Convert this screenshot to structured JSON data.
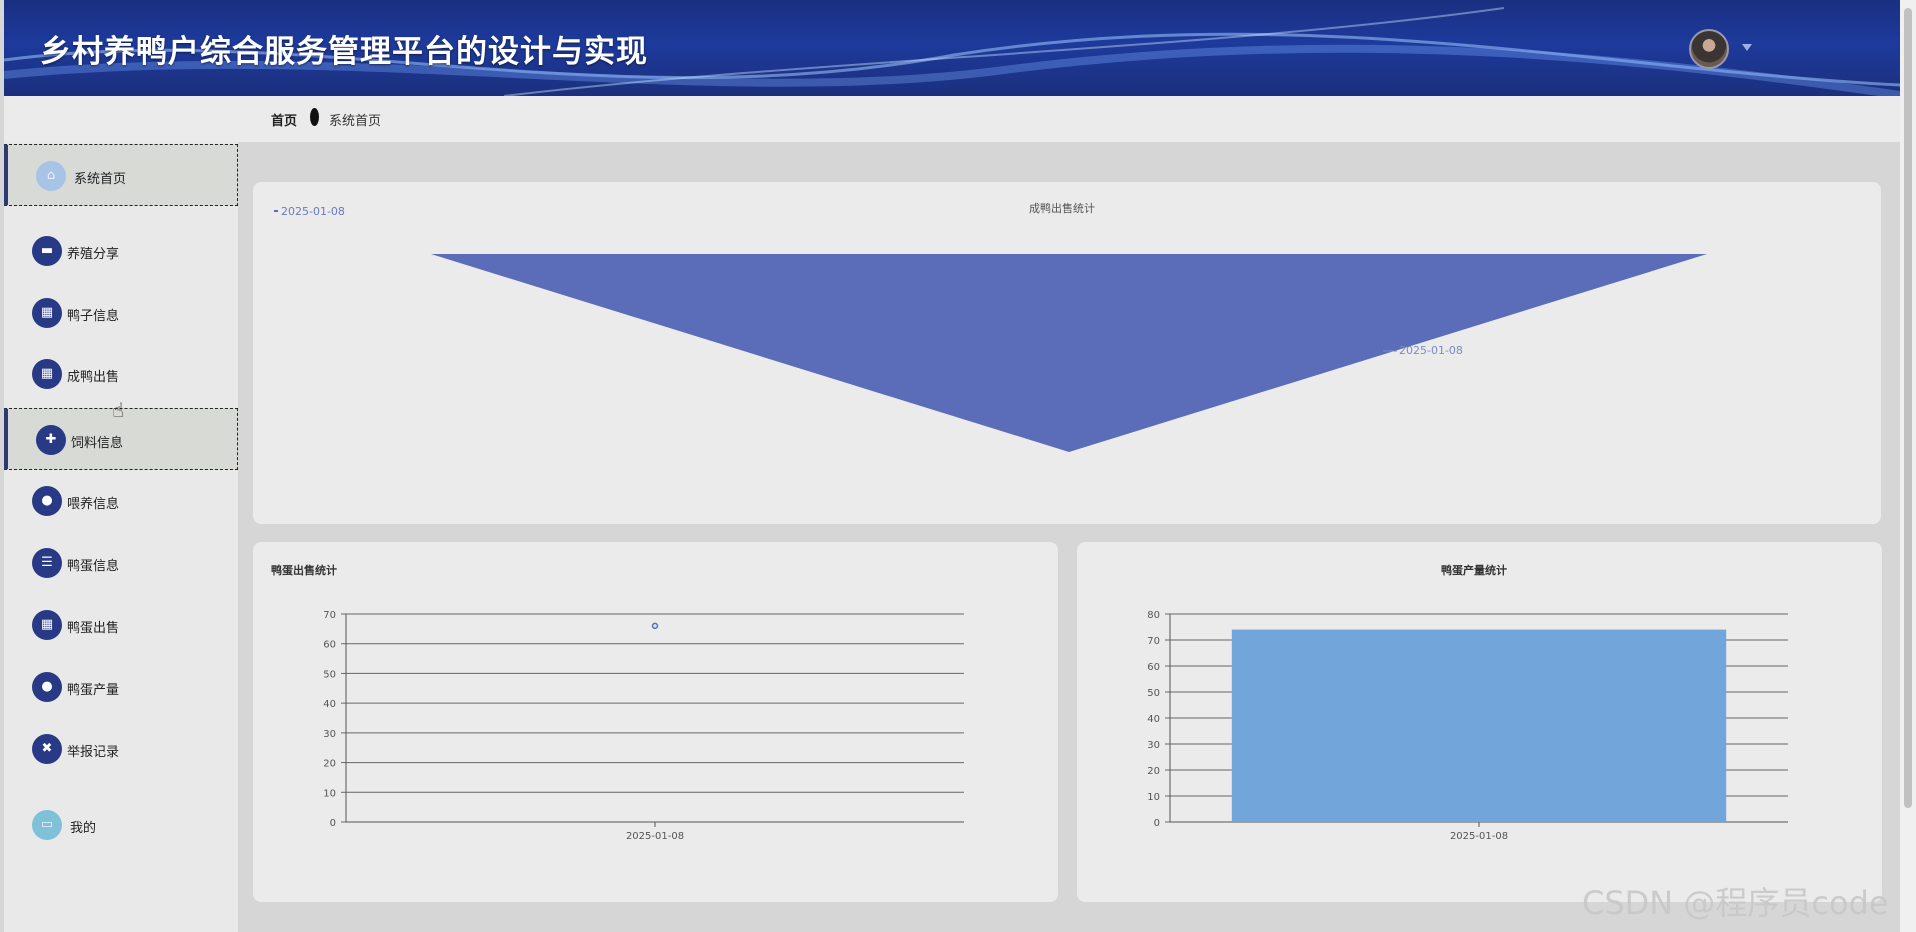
{
  "header": {
    "title": "乡村养鸭户综合服务管理平台的设计与实现"
  },
  "breadcrumb": {
    "home": "首页",
    "current": "系统首页"
  },
  "sidebar": {
    "items": [
      {
        "label": "系统首页",
        "icon": "home-icon",
        "active": true
      },
      {
        "label": "养殖分享",
        "icon": "book-icon"
      },
      {
        "label": "鸭子信息",
        "icon": "grid-icon"
      },
      {
        "label": "成鸭出售",
        "icon": "grid-icon"
      },
      {
        "label": "饲料信息",
        "icon": "puzzle-icon",
        "active": true
      },
      {
        "label": "喂养信息",
        "icon": "location-icon"
      },
      {
        "label": "鸭蛋信息",
        "icon": "list-icon"
      },
      {
        "label": "鸭蛋出售",
        "icon": "grid-icon"
      },
      {
        "label": "鸭蛋产量",
        "icon": "user-icon"
      },
      {
        "label": "举报记录",
        "icon": "ticket-icon"
      },
      {
        "label": "我的",
        "icon": "card-icon"
      }
    ]
  },
  "chart_data": [
    {
      "type": "funnel",
      "title": "成鸭出售统计",
      "legend": [
        "2025-01-08"
      ],
      "categories": [
        "2025-01-08"
      ],
      "values": [
        1
      ],
      "data_label": "2025-01-08",
      "color": "#5b6db9"
    },
    {
      "type": "scatter",
      "title": "鸭蛋出售统计",
      "categories": [
        "2025-01-08"
      ],
      "values": [
        66
      ],
      "ylim": [
        0,
        70
      ],
      "yticks": [
        0,
        10,
        20,
        30,
        40,
        50,
        60,
        70
      ],
      "grid": true,
      "color": "#5b6db9"
    },
    {
      "type": "bar",
      "title": "鸭蛋产量统计",
      "categories": [
        "2025-01-08"
      ],
      "values": [
        74
      ],
      "ylim": [
        0,
        80
      ],
      "yticks": [
        0,
        10,
        20,
        30,
        40,
        50,
        60,
        70,
        80
      ],
      "grid": true,
      "color": "#72a6da"
    }
  ],
  "watermark": "CSDN @程序员code"
}
